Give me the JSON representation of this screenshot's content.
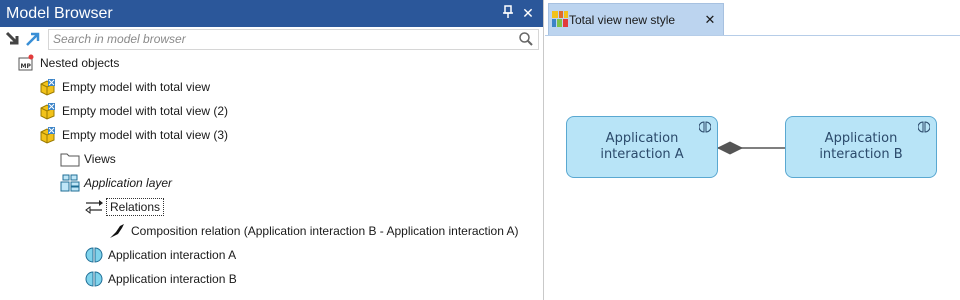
{
  "model_browser": {
    "title": "Model Browser",
    "pin_glyph": "⍘",
    "close_glyph": "✕",
    "search": {
      "placeholder": "Search in model browser",
      "value": ""
    },
    "tree": [
      {
        "label": "Nested objects",
        "icon": "model-package-icon",
        "italic": false
      },
      {
        "label": "Empty model with total view",
        "icon": "model-icon",
        "italic": false
      },
      {
        "label": "Empty model with total view (2)",
        "icon": "model-icon",
        "italic": false
      },
      {
        "label": "Empty model with total view (3)",
        "icon": "model-icon",
        "italic": false
      },
      {
        "label": "Views",
        "icon": "folder-icon",
        "italic": false
      },
      {
        "label": "Application layer",
        "icon": "application-layer-icon",
        "italic": true
      },
      {
        "label": "Relations",
        "icon": "relations-icon",
        "italic": false
      },
      {
        "label": "Composition relation (Application interaction B - Application interaction A)",
        "icon": "composition-icon",
        "italic": false
      },
      {
        "label": "Application interaction A",
        "icon": "application-interaction-icon",
        "italic": false
      },
      {
        "label": "Application interaction B",
        "icon": "application-interaction-icon",
        "italic": false
      }
    ]
  },
  "diagram": {
    "tab": {
      "label": "Total view new style",
      "close_glyph": "✕"
    },
    "elements": [
      {
        "label": "Application interaction A"
      },
      {
        "label": "Application interaction B"
      }
    ]
  },
  "colors": {
    "titlebar": "#2b579a",
    "tab": "#bcd4ef",
    "element_fill": "#b8e4f7",
    "element_border": "#5aa8d1"
  }
}
